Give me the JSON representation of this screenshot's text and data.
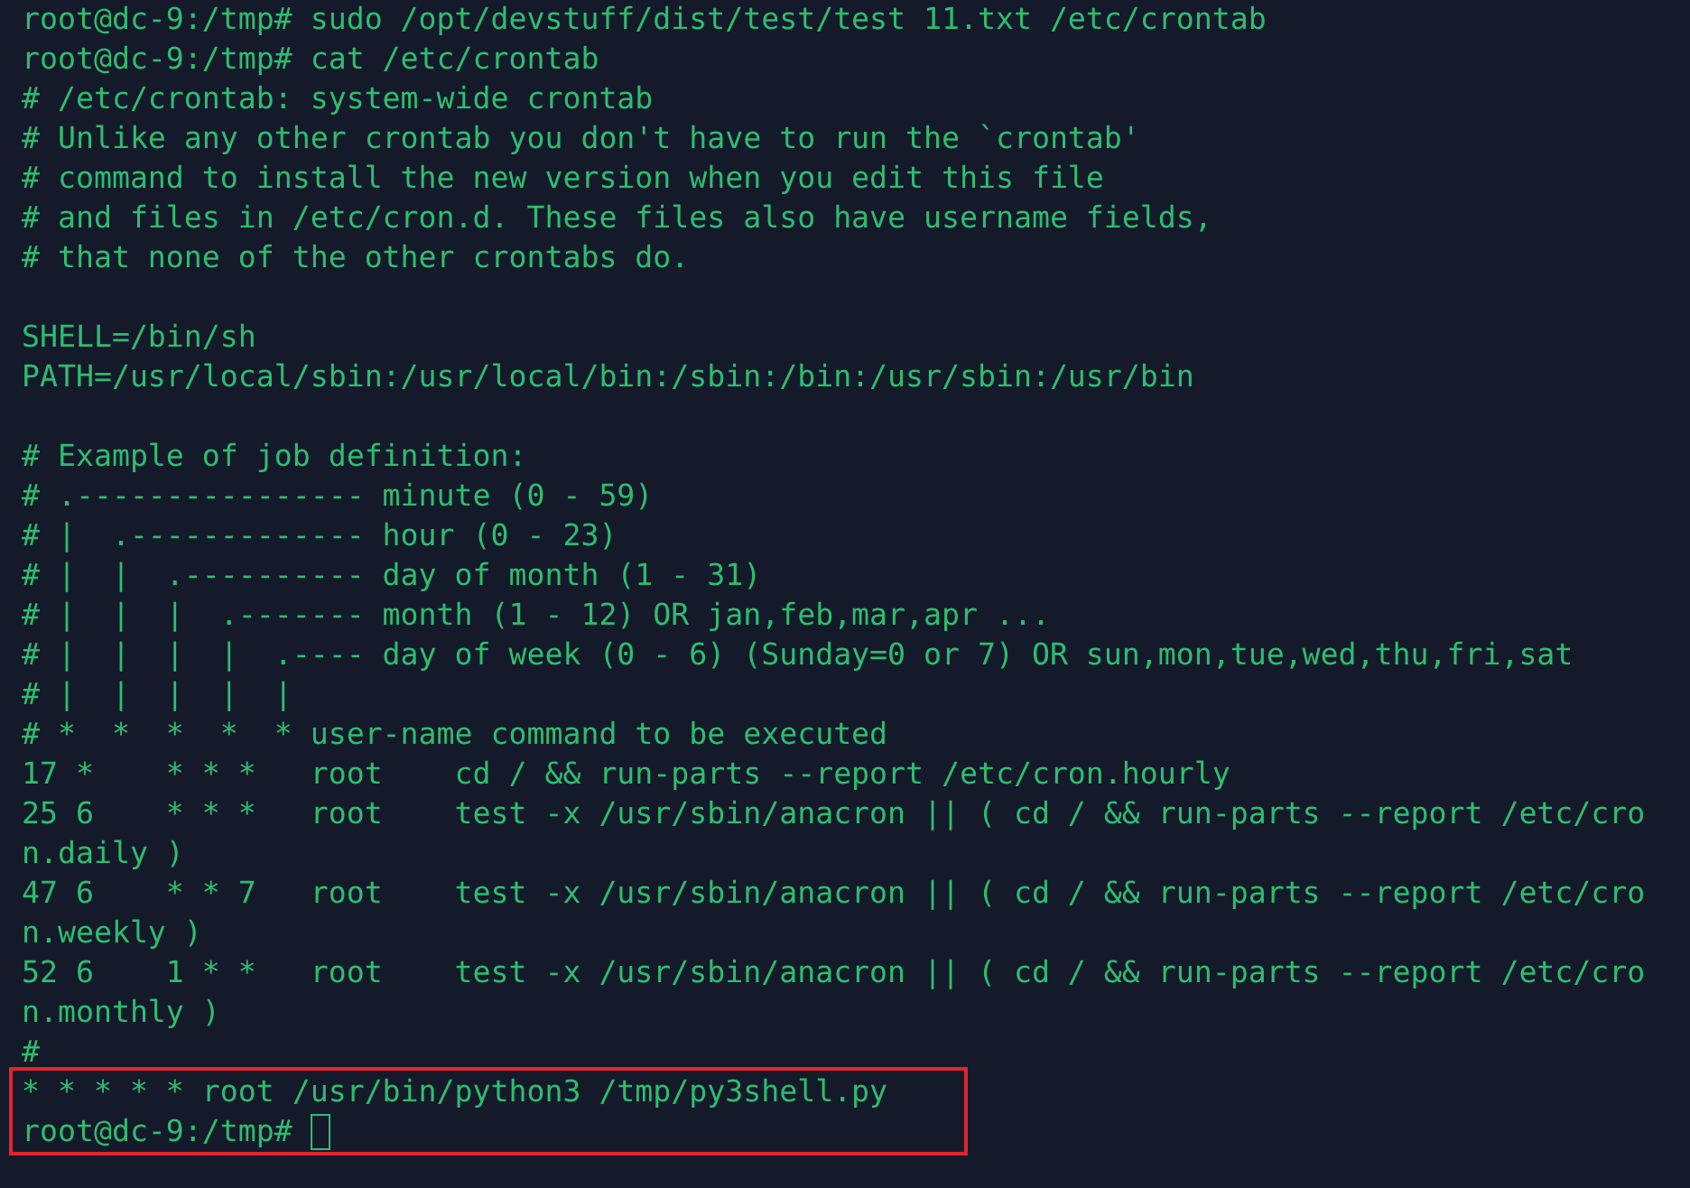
{
  "lines": [
    {
      "kind": "text",
      "text": "root@dc-9:/tmp# sudo /opt/devstuff/dist/test/test 11.txt /etc/crontab"
    },
    {
      "kind": "text",
      "text": "root@dc-9:/tmp# cat /etc/crontab"
    },
    {
      "kind": "text",
      "text": "# /etc/crontab: system-wide crontab"
    },
    {
      "kind": "text",
      "text": "# Unlike any other crontab you don't have to run the `crontab'"
    },
    {
      "kind": "text",
      "text": "# command to install the new version when you edit this file"
    },
    {
      "kind": "text",
      "text": "# and files in /etc/cron.d. These files also have username fields,"
    },
    {
      "kind": "text",
      "text": "# that none of the other crontabs do."
    },
    {
      "kind": "blank"
    },
    {
      "kind": "text",
      "text": "SHELL=/bin/sh"
    },
    {
      "kind": "text",
      "text": "PATH=/usr/local/sbin:/usr/local/bin:/sbin:/bin:/usr/sbin:/usr/bin"
    },
    {
      "kind": "blank"
    },
    {
      "kind": "text",
      "text": "# Example of job definition:"
    },
    {
      "kind": "text",
      "text": "# .---------------- minute (0 - 59)"
    },
    {
      "kind": "text",
      "text": "# |  .------------- hour (0 - 23)"
    },
    {
      "kind": "text",
      "text": "# |  |  .---------- day of month (1 - 31)"
    },
    {
      "kind": "text",
      "text": "# |  |  |  .------- month (1 - 12) OR jan,feb,mar,apr ..."
    },
    {
      "kind": "text",
      "text": "# |  |  |  |  .---- day of week (0 - 6) (Sunday=0 or 7) OR sun,mon,tue,wed,thu,fri,sat"
    },
    {
      "kind": "text",
      "text": "# |  |  |  |  |"
    },
    {
      "kind": "text",
      "text": "# *  *  *  *  * user-name command to be executed"
    },
    {
      "kind": "text",
      "text": "17 *    * * *   root    cd / && run-parts --report /etc/cron.hourly"
    },
    {
      "kind": "text",
      "text": "25 6    * * *   root    test -x /usr/sbin/anacron || ( cd / && run-parts --report /etc/cro"
    },
    {
      "kind": "text",
      "text": "n.daily )"
    },
    {
      "kind": "text",
      "text": "47 6    * * 7   root    test -x /usr/sbin/anacron || ( cd / && run-parts --report /etc/cro"
    },
    {
      "kind": "text",
      "text": "n.weekly )"
    },
    {
      "kind": "text",
      "text": "52 6    1 * *   root    test -x /usr/sbin/anacron || ( cd / && run-parts --report /etc/cro"
    },
    {
      "kind": "text",
      "text": "n.monthly )"
    },
    {
      "kind": "text",
      "text": "#"
    }
  ],
  "highlighted_block": {
    "lines": [
      "* * * * * root /usr/bin/python3 /tmp/py3shell.py"
    ],
    "prompt": "root@dc-9:/tmp#",
    "cursor": true
  }
}
